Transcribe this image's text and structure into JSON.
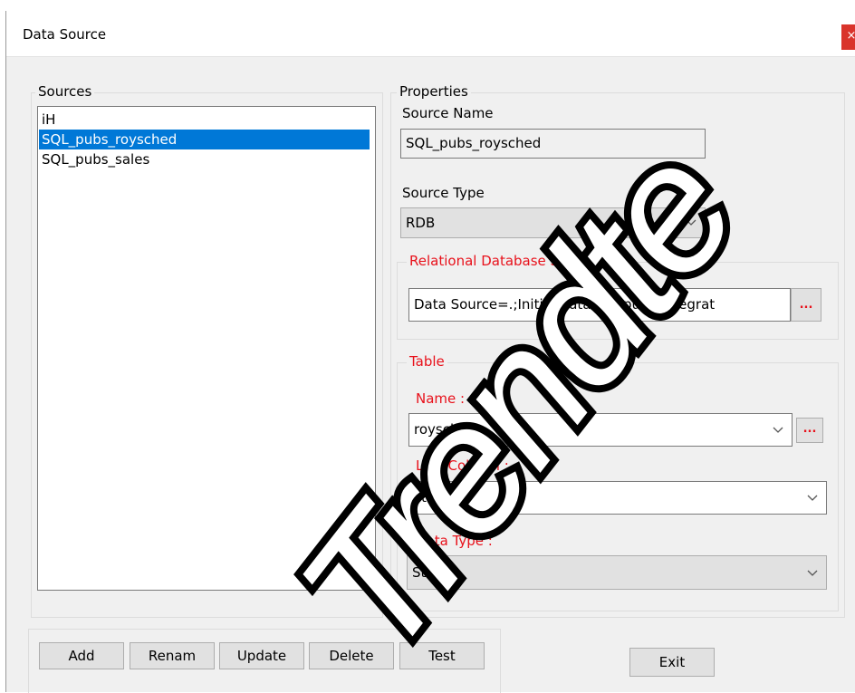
{
  "window": {
    "title": "Data Source",
    "close_label": "×"
  },
  "sources": {
    "label": "Sources",
    "items": [
      "iH",
      "SQL_pubs_roysched",
      "SQL_pubs_sales"
    ],
    "selected_index": 1
  },
  "properties": {
    "label": "Properties",
    "source_name_label": "Source Name",
    "source_name_value": "SQL_pubs_roysched",
    "source_type_label": "Source Type",
    "source_type_value": "RDB",
    "rdb": {
      "label": "Relational Database Source",
      "connection_value": "Data Source=.;Initial Catalog=pubs;Integrat",
      "browse_label": "..."
    },
    "table": {
      "label": "Table",
      "name_label": "Name :",
      "name_value": "roysched",
      "name_browse_label": "...",
      "link_column_label": "Link Column :",
      "link_column_value": "title_id",
      "data_type_label": "Data Type :",
      "data_type_value": "String"
    }
  },
  "buttons": {
    "add": "Add",
    "rename": "Renam",
    "update": "Update",
    "delete": "Delete",
    "test": "Test",
    "exit": "Exit"
  },
  "watermark": {
    "text": "Trendte"
  },
  "colors": {
    "accent_red": "#e8111b",
    "selection_blue": "#0078d7",
    "close_red": "#d9342b"
  }
}
